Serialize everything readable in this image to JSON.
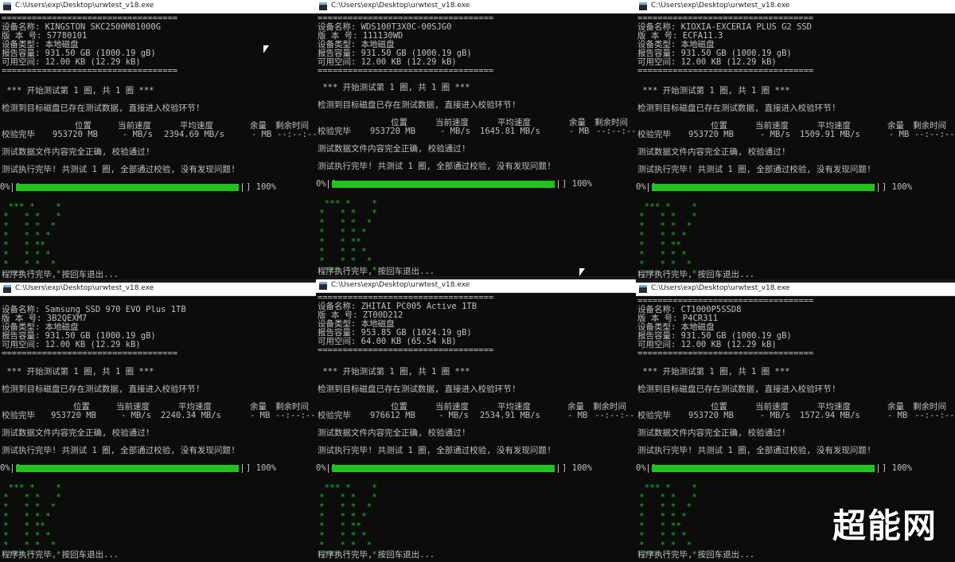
{
  "watermark": "超能网",
  "windows": [
    {
      "title": "C:\\Users\\exp\\Desktop\\urwtest_v18.exe",
      "sep": "===================================",
      "device": "设备名称: KINGSTON SKC2500M81000G",
      "version": "版 本 号: S7780101",
      "type": "设备类型: 本地磁盘",
      "capacity": "报告容量: 931.50 GB (1000.19 gB)",
      "free": "可用空间: 12.00 KB (12.29 kB)",
      "start": " *** 开始测试第 1 圈, 共 1 圈 ***",
      "detect": "检测到目标磁盘已存在测试数据, 直接进入校验环节!",
      "hdr_pos": "位置",
      "hdr_cur": "当前速度",
      "hdr_avg": "平均速度",
      "hdr_rem": "余量",
      "hdr_time": "剩余时间",
      "status": "校验完毕",
      "pos": "953720 MB",
      "cur": "- MB/s",
      "avg": "2394.69 MB/s",
      "rem": "- MB",
      "time": "--:--:--",
      "verify_ok": "测试数据文件内容完全正确, 校验通过!",
      "done": "测试执行完毕! 共测试 1 圈, 全部通过校验, 没有发现问题!",
      "pct_start": "0% [",
      "pct_end": "] 100%",
      "progress": 100,
      "ok_art": " *** *    *\n*   * *   *\n*   * *  *\n*   * * *\n*   * **\n*   * * *\n*   * *  *\n *** *    *",
      "exit": "程序执行完毕, 按回车退出..."
    },
    {
      "title": "C:\\Users\\exp\\Desktop\\urwtest_v18.exe",
      "sep": "===================================",
      "device": "设备名称: WDS100T3X0C-00SJG0",
      "version": "版 本 号: 111130WD",
      "type": "设备类型: 本地磁盘",
      "capacity": "报告容量: 931.50 GB (1000.19 gB)",
      "free": "可用空间: 12.00 KB (12.29 kB)",
      "start": " *** 开始测试第 1 圈, 共 1 圈 ***",
      "detect": "检测到目标磁盘已存在测试数据, 直接进入校验环节!",
      "hdr_pos": "位置",
      "hdr_cur": "当前速度",
      "hdr_avg": "平均速度",
      "hdr_rem": "余量",
      "hdr_time": "剩余时间",
      "status": "校验完毕",
      "pos": "953720 MB",
      "cur": "- MB/s",
      "avg": "1645.81 MB/s",
      "rem": "- MB",
      "time": "--:--:--",
      "verify_ok": "测试数据文件内容完全正确, 校验通过!",
      "done": "测试执行完毕! 共测试 1 圈, 全部通过校验, 没有发现问题!",
      "pct_start": "0% [",
      "pct_end": "] 100%",
      "progress": 100,
      "ok_art": " *** *    *\n*   * *   *\n*   * *  *\n*   * * *\n*   * **\n*   * * *\n*   * *  *\n *** *    *",
      "exit": "程序执行完毕, 按回车退出..."
    },
    {
      "title": "C:\\Users\\exp\\Desktop\\urwtest_v18.exe",
      "sep": "===================================",
      "device": "设备名称: KIOXIA-EXCERIA PLUS G2 SSD",
      "version": "版 本 号: ECFA11.3",
      "type": "设备类型: 本地磁盘",
      "capacity": "报告容量: 931.50 GB (1000.19 gB)",
      "free": "可用空间: 12.00 KB (12.29 kB)",
      "start": " *** 开始测试第 1 圈, 共 1 圈 ***",
      "detect": "检测到目标磁盘已存在测试数据, 直接进入校验环节!",
      "hdr_pos": "位置",
      "hdr_cur": "当前速度",
      "hdr_avg": "平均速度",
      "hdr_rem": "余量",
      "hdr_time": "剩余时间",
      "status": "校验完毕",
      "pos": "953720 MB",
      "cur": "- MB/s",
      "avg": "1509.91 MB/s",
      "rem": "- MB",
      "time": "--:--:--",
      "verify_ok": "测试数据文件内容完全正确, 校验通过!",
      "done": "测试执行完毕! 共测试 1 圈, 全部通过校验, 没有发现问题!",
      "pct_start": "0% [",
      "pct_end": "] 100%",
      "progress": 100,
      "ok_art": " *** *    *\n*   * *   *\n*   * *  *\n*   * * *\n*   * **\n*   * * *\n*   * *  *\n *** *    *",
      "exit": "程序执行完毕, 按回车退出..."
    },
    {
      "title": "C:\\Users\\exp\\Desktop\\urwtest_v18.exe",
      "sep": "===================================",
      "device": "设备名称: Samsung SSD 970 EVO Plus 1TB",
      "version": "版 本 号: 3B2QEXM7",
      "type": "设备类型: 本地磁盘",
      "capacity": "报告容量: 931.50 GB (1000.19 gB)",
      "free": "可用空间: 12.00 KB (12.29 kB)",
      "start": " *** 开始测试第 1 圈, 共 1 圈 ***",
      "detect": "检测到目标磁盘已存在测试数据, 直接进入校验环节!",
      "hdr_pos": "位置",
      "hdr_cur": "当前速度",
      "hdr_avg": "平均速度",
      "hdr_rem": "余量",
      "hdr_time": "剩余时间",
      "status": "校验完毕",
      "pos": "953720 MB",
      "cur": "- MB/s",
      "avg": "2240.34 MB/s",
      "rem": "- MB",
      "time": "--:--:--",
      "verify_ok": "测试数据文件内容完全正确, 校验通过!",
      "done": "测试执行完毕! 共测试 1 圈, 全部通过校验, 没有发现问题!",
      "pct_start": "0% [",
      "pct_end": "] 100%",
      "progress": 100,
      "ok_art": " *** *    *\n*   * *   *\n*   * *  *\n*   * * *\n*   * **\n*   * * *\n*   * *  *\n *** *    *",
      "exit": "程序执行完毕, 按回车退出..."
    },
    {
      "title": "C:\\Users\\exp\\Desktop\\urwtest_v18.exe",
      "sep": "===================================",
      "device": "设备名称: ZHITAI PC005 Active 1TB",
      "version": "版 本 号: ZT00D212",
      "type": "设备类型: 本地磁盘",
      "capacity": "报告容量: 953.85 GB (1024.19 gB)",
      "free": "可用空间: 64.00 KB (65.54 kB)",
      "start": " *** 开始测试第 1 圈, 共 1 圈 ***",
      "detect": "检测到目标磁盘已存在测试数据, 直接进入校验环节!",
      "hdr_pos": "位置",
      "hdr_cur": "当前速度",
      "hdr_avg": "平均速度",
      "hdr_rem": "余量",
      "hdr_time": "剩余时间",
      "status": "校验完毕",
      "pos": "976612 MB",
      "cur": "- MB/s",
      "avg": "2534.91 MB/s",
      "rem": "- MB",
      "time": "--:--:--",
      "verify_ok": "测试数据文件内容完全正确, 校验通过!",
      "done": "测试执行完毕! 共测试 1 圈, 全部通过校验, 没有发现问题!",
      "pct_start": "0% [",
      "pct_end": "] 100%",
      "progress": 100,
      "ok_art": " *** *    *\n*   * *   *\n*   * *  *\n*   * * *\n*   * **\n*   * * *\n*   * *  *\n *** *    *",
      "exit": "程序执行完毕, 按回车退出..."
    },
    {
      "title": "C:\\Users\\exp\\Desktop\\urwtest_v18.exe",
      "sep": "===================================",
      "device": "设备名称: CT1000P5SSD8",
      "version": "版 本 号: P4CR311",
      "type": "设备类型: 本地磁盘",
      "capacity": "报告容量: 931.50 GB (1000.19 gB)",
      "free": "可用空间: 12.00 KB (12.29 kB)",
      "start": " *** 开始测试第 1 圈, 共 1 圈 ***",
      "detect": "检测到目标磁盘已存在测试数据, 直接进入校验环节!",
      "hdr_pos": "位置",
      "hdr_cur": "当前速度",
      "hdr_avg": "平均速度",
      "hdr_rem": "余量",
      "hdr_time": "剩余时间",
      "status": "校验完毕",
      "pos": "953720 MB",
      "cur": "- MB/s",
      "avg": "1572.94 MB/s",
      "rem": "- MB",
      "time": "--:--:--",
      "verify_ok": "测试数据文件内容完全正确, 校验通过!",
      "done": "测试执行完毕! 共测试 1 圈, 全部通过校验, 没有发现问题!",
      "pct_start": "0% [",
      "pct_end": "] 100%",
      "progress": 100,
      "ok_art": " *** *    *\n*   * *   *\n*   * *  *\n*   * * *\n*   * **\n*   * * *\n*   * *  *\n *** *    *",
      "exit": "程序执行完毕, 按回车退出..."
    }
  ]
}
